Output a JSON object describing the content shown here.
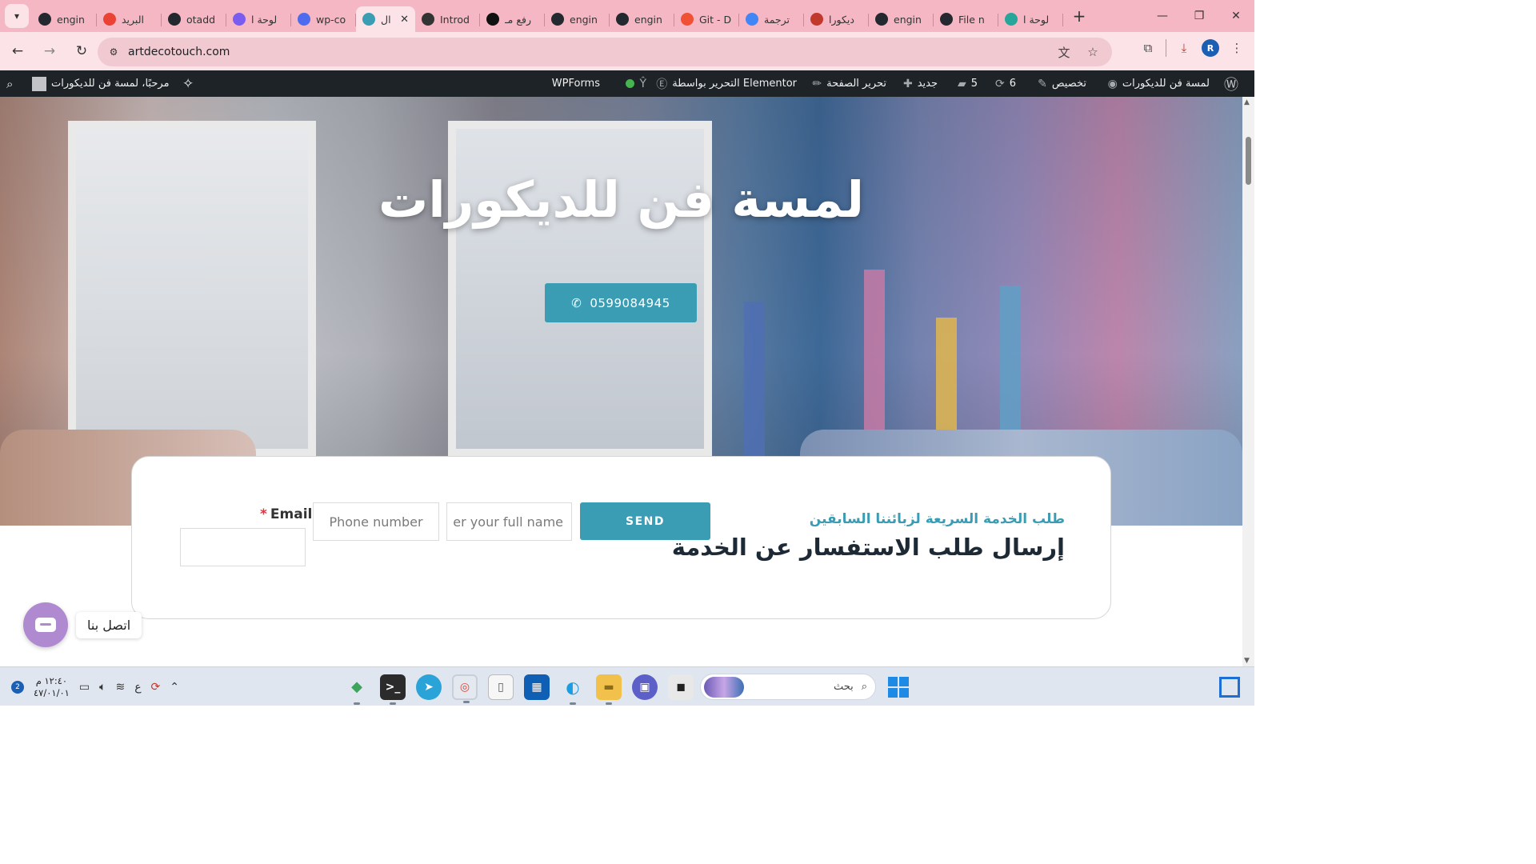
{
  "browser": {
    "tabs": [
      {
        "title": "engin",
        "icon": "github-icon",
        "color": "#24292f"
      },
      {
        "title": "البريد",
        "icon": "gmail-icon",
        "color": "#ea4335"
      },
      {
        "title": "otadd",
        "icon": "github-icon",
        "color": "#24292f"
      },
      {
        "title": "لوحة ا",
        "icon": "app-icon",
        "color": "#7b5cf0"
      },
      {
        "title": "wp-co",
        "icon": "wp-icon",
        "color": "#4f6bed"
      },
      {
        "title": "ال",
        "icon": "site-icon",
        "color": "#3a9db3"
      },
      {
        "title": "Introd",
        "icon": "openai-icon",
        "color": "#333333"
      },
      {
        "title": "رفع مـ",
        "icon": "openai-icon",
        "color": "#111111"
      },
      {
        "title": "engin",
        "icon": "github-icon",
        "color": "#24292f"
      },
      {
        "title": "engin",
        "icon": "github-icon",
        "color": "#24292f"
      },
      {
        "title": "Git - D",
        "icon": "git-icon",
        "color": "#f05033"
      },
      {
        "title": "ترجمة",
        "icon": "google-icon",
        "color": "#4285f4"
      },
      {
        "title": "ديكورا",
        "icon": "image-icon",
        "color": "#c0392b"
      },
      {
        "title": "engin",
        "icon": "github-icon",
        "color": "#24292f"
      },
      {
        "title": "File n",
        "icon": "github-icon",
        "color": "#24292f"
      },
      {
        "title": "لوحة ا",
        "icon": "app-icon",
        "color": "#26a69a"
      }
    ],
    "active_tab_index": 5,
    "url": "artdecotouch.com",
    "profile_initial": "R"
  },
  "adminbar": {
    "site_name": "لمسة فن للديكورات",
    "customize": "تخصيص",
    "updates": "6",
    "comments": "5",
    "new": "جديد",
    "edit_page": "تحرير الصفحة",
    "edit_elementor": "التحرير بواسطة Elementor",
    "wpforms": "WPForms",
    "greeting": "مرحبًا، لمسة فن للديكورات"
  },
  "hero": {
    "title": "لمسة فن للديكورات",
    "phone": "0599084945"
  },
  "form": {
    "subtitle": "طلب الخدمة السريعة لزبائننا السابقين",
    "title": "إرسال طلب الاستفسار عن الخدمة",
    "send_label": "SEND",
    "name_placeholder": "er your full name",
    "phone_placeholder": "Phone number",
    "email_label": "Email",
    "required_mark": "*"
  },
  "contact_widget": {
    "label": "اتصل بنا"
  },
  "taskbar": {
    "time": "١٢:٤٠ م",
    "date": "٤٧/٠١/٠١",
    "lang": "ع",
    "search_placeholder": "بحث"
  },
  "colors": {
    "accent": "#3a9db3",
    "tab_strip": "#f5b7c3",
    "toolbar": "#fbe3e8",
    "adminbar": "#1d2327",
    "contact_fab": "#b08ad0"
  }
}
